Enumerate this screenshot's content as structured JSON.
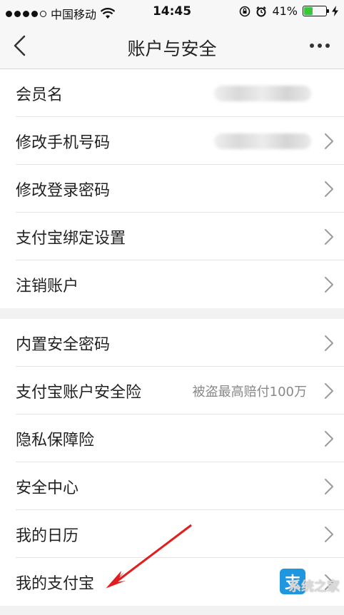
{
  "status_bar": {
    "carrier": "中国移动",
    "time": "14:45",
    "battery": "41%",
    "battery_level": 0.41
  },
  "nav": {
    "title": "账户与安全"
  },
  "group1": [
    {
      "label": "会员名",
      "value": "",
      "blurred": true
    },
    {
      "label": "修改手机号码",
      "value": "",
      "blurred": true
    },
    {
      "label": "修改登录密码",
      "value": ""
    },
    {
      "label": "支付宝绑定设置",
      "value": ""
    },
    {
      "label": "注销账户",
      "value": ""
    }
  ],
  "group2": [
    {
      "label": "内置安全密码",
      "value": ""
    },
    {
      "label": "支付宝账户安全险",
      "value": "被盗最高赔付100万"
    },
    {
      "label": "隐私保障险",
      "value": ""
    },
    {
      "label": "安全中心",
      "value": ""
    },
    {
      "label": "我的日历",
      "value": ""
    },
    {
      "label": "我的支付宝",
      "value": "",
      "icon": "alipay-icon",
      "icon_glyph": "支"
    }
  ],
  "watermark": "系统之家",
  "colors": {
    "accent_annotation": "#e11d1d",
    "alipay_blue": "#1e96e0",
    "battery_green": "#3ac53a"
  }
}
